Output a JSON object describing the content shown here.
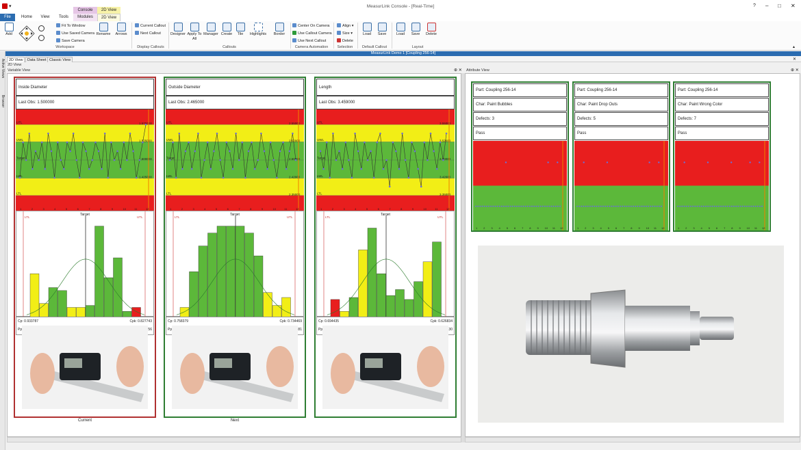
{
  "app": {
    "title": "MeasurLink Console - [Real-Time]",
    "doc_title": "MeasurLink Demo 1 [Coupling 256-14]"
  },
  "menu": {
    "file": "File",
    "home": "Home",
    "view": "View",
    "tools": "Tools",
    "context_console": "Console",
    "context_2d": "2D View",
    "modules": "Modules",
    "view2d": "2D View"
  },
  "ribbon": {
    "workspace": {
      "label": "Workspace",
      "add": "Add",
      "fit": "Fit To Window",
      "use_saved": "Use Saved Camera",
      "save_camera": "Save Camera",
      "rename": "Rename",
      "arrows": "Arrows"
    },
    "display_callouts": {
      "label": "Display Callouts",
      "current": "Current Callout",
      "next": "Next Callout"
    },
    "callouts": {
      "label": "Callouts",
      "designer": "Designer",
      "apply": "Apply To All",
      "manager": "Manager",
      "create": "Create",
      "tile": "Tile",
      "highlights": "Highlights",
      "border": "Border"
    },
    "camera": {
      "label": "Camera Automation",
      "center": "Center On Camera",
      "use_callout": "Use Callout Camera",
      "use_next": "Use Next Callout"
    },
    "selection": {
      "label": "Selection",
      "align": "Align",
      "size": "Size",
      "delete": "Delete"
    },
    "default_callout": {
      "label": "Default Callout",
      "load": "Load",
      "save": "Save"
    },
    "layout": {
      "label": "Layout",
      "load": "Load",
      "save": "Save",
      "delete": "Delete"
    }
  },
  "sidebar": {
    "active_views": "Active Views",
    "browser": "Browser"
  },
  "view_tabs": [
    "2D View",
    "Data Sheet",
    "Classic View"
  ],
  "panel": {
    "header": "2D View",
    "variable": "Variable View",
    "attribute": "Attribute View"
  },
  "variable_cards": [
    {
      "title": "Inside Diameter",
      "last_obs": "Last Obs: 1.500000",
      "cp": "Cp: 0.933787",
      "cpk": "Cpk: 0.827743",
      "pp": "Pp: 0.636878",
      "ppk": "Ppk: 0.632756",
      "caption": "Current",
      "border": "#b03030",
      "y_tick_labels": [
        "1.575000",
        "1.525000",
        "1.500000",
        "1.425000"
      ],
      "limit_labels": [
        "UTL",
        "UWL",
        "Target",
        "LWL",
        "LTL"
      ],
      "points": [
        2,
        6,
        4,
        7,
        3,
        5,
        4,
        6,
        3,
        7,
        5,
        2,
        6,
        4,
        3,
        6,
        5,
        7,
        4,
        2,
        6,
        5,
        3,
        4,
        6,
        5,
        3,
        7,
        2,
        6,
        4,
        5,
        3,
        6,
        4,
        7,
        5,
        2,
        4,
        6,
        8
      ],
      "hist": [
        0,
        0,
        0,
        0,
        0,
        0,
        0,
        0,
        0,
        0,
        0,
        0,
        0,
        0,
        0,
        0,
        0,
        0,
        0
      ],
      "hist_values": [
        {
          "v": 0.44,
          "c": "y"
        },
        {
          "v": 0.14,
          "c": "y"
        },
        {
          "v": 0.3,
          "c": "g"
        },
        {
          "v": 0.27,
          "c": "g"
        },
        {
          "v": 0.1,
          "c": "y"
        },
        {
          "v": 0.1,
          "c": "y"
        },
        {
          "v": 0.12,
          "c": "g"
        },
        {
          "v": 0.92,
          "c": "g"
        },
        {
          "v": 0.4,
          "c": "g"
        },
        {
          "v": 0.6,
          "c": "g"
        },
        {
          "v": 0.06,
          "c": "g"
        },
        {
          "v": 0.1,
          "c": "r"
        }
      ],
      "x_ticks": [
        "1",
        "2",
        "3",
        "4",
        "5",
        "6",
        "7",
        "8",
        "9",
        "10",
        "11",
        "12"
      ],
      "target_label": "Target",
      "ltl": "LTL",
      "utl": "UTL"
    },
    {
      "title": "Outside Diameter",
      "last_obs": "Last Obs: 2.465000",
      "cp": "Cp: 0.758379",
      "cpk": "Cpk: 0.734469",
      "pp": "Pp: 0.827367",
      "ppk": "Ppk: 0.801281",
      "caption": "Next",
      "border": "#2e7d32",
      "y_tick_labels": [
        "2.55000",
        "2.52000",
        "2.50000",
        "2.42000",
        "2.35000"
      ],
      "limit_labels": [
        "UTL",
        "UWL",
        "Target",
        "LWL",
        "LTL"
      ],
      "points": [
        4,
        6,
        2,
        7,
        3,
        5,
        6,
        3,
        5,
        7,
        2,
        4,
        6,
        3,
        5,
        7,
        4,
        2,
        6,
        5,
        3,
        7,
        4,
        6,
        2,
        5,
        6,
        3,
        4,
        7,
        5,
        3,
        6,
        4,
        2,
        5,
        6,
        3,
        5,
        7,
        4
      ],
      "hist_values": [
        {
          "v": 0.1,
          "c": "y"
        },
        {
          "v": 0.46,
          "c": "g"
        },
        {
          "v": 0.72,
          "c": "g"
        },
        {
          "v": 0.85,
          "c": "g"
        },
        {
          "v": 0.92,
          "c": "g"
        },
        {
          "v": 0.92,
          "c": "g"
        },
        {
          "v": 0.92,
          "c": "g"
        },
        {
          "v": 0.85,
          "c": "g"
        },
        {
          "v": 0.62,
          "c": "g"
        },
        {
          "v": 0.25,
          "c": "y"
        },
        {
          "v": 0.12,
          "c": "y"
        },
        {
          "v": 0.2,
          "c": "y"
        }
      ],
      "x_ticks": [
        "1",
        "2",
        "3",
        "4",
        "5",
        "6",
        "7",
        "8",
        "9",
        "10",
        "11",
        "12"
      ],
      "target_label": "Target",
      "ltl": "LTL",
      "utl": "UTL"
    },
    {
      "title": "Length",
      "last_obs": "Last Obs: 3.459000",
      "cp": "Cp: 0.694435",
      "cpk": "Cpk: 0.626834",
      "pp": "Pp: 0.718039",
      "ppk": "Ppk: 0.648130",
      "caption": "",
      "border": "#2e7d32",
      "y_tick_labels": [
        "3.55000",
        "3.52000",
        "3.50000",
        "3.42000",
        "3.35000"
      ],
      "limit_labels": [
        "UTL",
        "UWL",
        "Target",
        "LWL",
        "LTL"
      ],
      "points": [
        5,
        3,
        6,
        2,
        7,
        4,
        5,
        3,
        6,
        4,
        2,
        7,
        5,
        3,
        6,
        4,
        5,
        2,
        6,
        7,
        3,
        4,
        1,
        6,
        5,
        3,
        7,
        4,
        2,
        6,
        5,
        3,
        1,
        6,
        4,
        7,
        5,
        3,
        6,
        4,
        7
      ],
      "hist_values": [
        {
          "v": 0.18,
          "c": "r"
        },
        {
          "v": 0.06,
          "c": "y"
        },
        {
          "v": 0.2,
          "c": "g"
        },
        {
          "v": 0.68,
          "c": "y"
        },
        {
          "v": 0.9,
          "c": "g"
        },
        {
          "v": 0.44,
          "c": "g"
        },
        {
          "v": 0.22,
          "c": "g"
        },
        {
          "v": 0.28,
          "c": "g"
        },
        {
          "v": 0.18,
          "c": "g"
        },
        {
          "v": 0.36,
          "c": "g"
        },
        {
          "v": 0.56,
          "c": "y"
        },
        {
          "v": 0.76,
          "c": "g"
        }
      ],
      "x_ticks": [
        "1",
        "2",
        "3",
        "4",
        "5",
        "6",
        "7",
        "8",
        "9",
        "10",
        "11",
        "12"
      ],
      "target_label": "Target",
      "ltl": "LTL",
      "utl": "UTL"
    }
  ],
  "attribute_cards": [
    {
      "part": "Part: Coupling 256-14",
      "char": "Char: Paint Bubbles",
      "defects": "Defects: 3",
      "result": "Pass"
    },
    {
      "part": "Part: Coupling 256-14",
      "char": "Char: Paint Drop Outs",
      "defects": "Defects: 5",
      "result": "Pass"
    },
    {
      "part": "Part: Coupling 256-14",
      "char": "Char: Paint Wrong Color",
      "defects": "Defects: 7",
      "result": "Pass"
    }
  ],
  "attr_x_ticks": [
    "1",
    "2",
    "3",
    "4",
    "5",
    "6",
    "7",
    "8",
    "9",
    "10",
    "11",
    "12"
  ],
  "colors": {
    "red": "#e81e1e",
    "yellow": "#f2ee16",
    "green": "#5cb83a",
    "ribbon_blue": "#2b6cb0"
  }
}
